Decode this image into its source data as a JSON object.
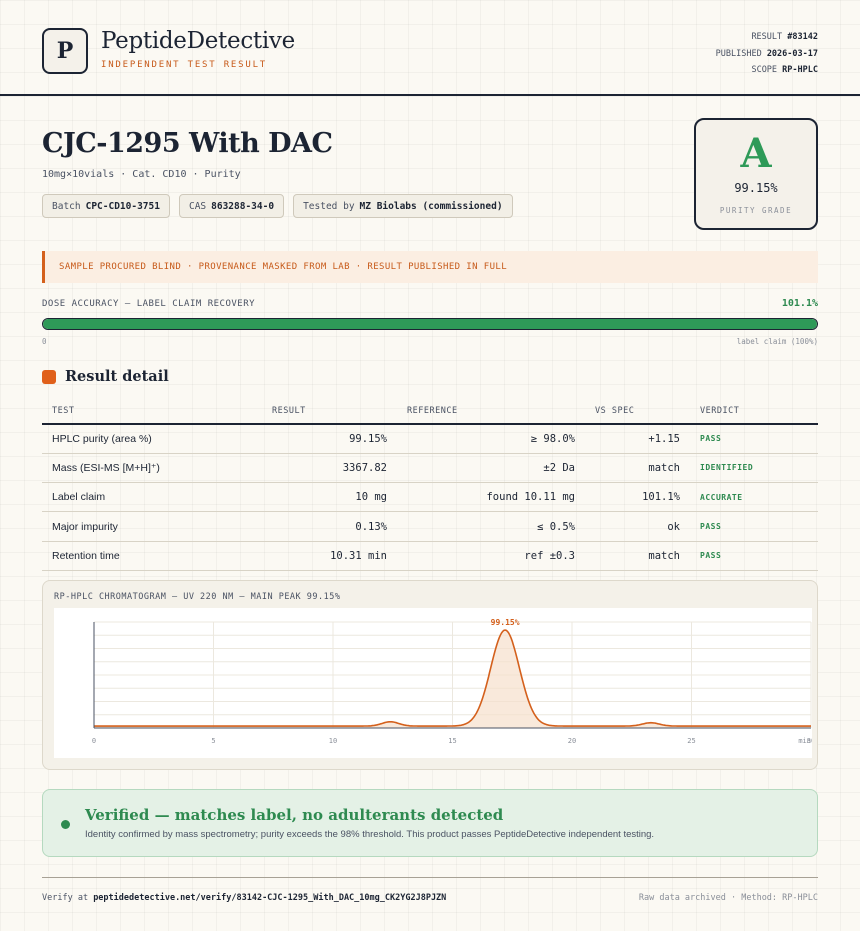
{
  "brand": {
    "logo_letter": "P",
    "name": "PeptideDetective",
    "tagline": "INDEPENDENT TEST RESULT"
  },
  "meta": {
    "result_label": "RESULT",
    "result_value": "#83142",
    "published_label": "PUBLISHED",
    "published_value": "2026-03-17",
    "scope_label": "SCOPE",
    "scope_value": "RP-HPLC"
  },
  "product": {
    "title": "CJC-1295 With DAC",
    "subtitle": "10mg×10vials · Cat. CD10 · Purity",
    "chips": {
      "batch_label": "Batch",
      "batch_value": "CPC-CD10-3751",
      "cas_label": "CAS",
      "cas_value": "863288-34-0",
      "tested_label": "Tested by",
      "tested_value": "MZ Biolabs (commissioned)"
    }
  },
  "grade": {
    "letter": "A",
    "percent": "99.15%",
    "label": "PURITY GRADE",
    "color": "#2e9a58"
  },
  "banner": "SAMPLE PROCURED BLIND · PROVENANCE MASKED FROM LAB · RESULT PUBLISHED IN FULL",
  "dose": {
    "label": "DOSE ACCURACY — LABEL CLAIM RECOVERY",
    "value_text": "101.1%",
    "fill_fraction": 1.0,
    "min_label": "0",
    "max_label": "label claim (100%)"
  },
  "section_title": "Result detail",
  "table": {
    "headers": [
      "TEST",
      "RESULT",
      "REFERENCE",
      "VS SPEC",
      "VERDICT"
    ],
    "rows": [
      {
        "test": "HPLC purity (area %)",
        "result": "99.15%",
        "reference": "≥ 98.0%",
        "vs_spec": "+1.15",
        "verdict": "PASS"
      },
      {
        "test": "Mass (ESI-MS [M+H]⁺)",
        "result": "3367.82",
        "reference": "±2 Da",
        "vs_spec": "match",
        "verdict": "IDENTIFIED"
      },
      {
        "test": "Label claim",
        "result": "10 mg",
        "reference": "found 10.11 mg",
        "vs_spec": "101.1%",
        "verdict": "ACCURATE"
      },
      {
        "test": "Major impurity",
        "result": "0.13%",
        "reference": "≤ 0.5%",
        "vs_spec": "ok",
        "verdict": "PASS"
      },
      {
        "test": "Retention time",
        "result": "10.31 min",
        "reference": "ref ±0.3",
        "vs_spec": "match",
        "verdict": "PASS"
      }
    ]
  },
  "chart_data": {
    "type": "line",
    "title": "RP-HPLC CHROMATOGRAM — UV 220 NM — MAIN PEAK 99.15%",
    "xlabel": "",
    "ylabel": "",
    "xlim": [
      0,
      30
    ],
    "x_ticks": [
      "0",
      "5",
      "10",
      "15",
      "20",
      "25",
      "30"
    ],
    "x_tick_suffix": "min",
    "baseline": 0.02,
    "peaks": [
      {
        "center": 12.4,
        "height": 0.045,
        "width": 0.35
      },
      {
        "center": 17.2,
        "height": 1.0,
        "width": 0.6,
        "label": "99.15%"
      },
      {
        "center": 23.3,
        "height": 0.035,
        "width": 0.35
      }
    ],
    "color": "#d4601c",
    "fill": "#f6dfcc"
  },
  "verified": {
    "title": "Verified — matches label, no adulterants detected",
    "text": "Identity confirmed by mass spectrometry; purity exceeds the 98% threshold. This product passes PeptideDetective independent testing."
  },
  "footer": {
    "verify_prefix": "Verify at",
    "verify_url": "peptidedetective.net/verify/83142-CJC-1295_With_DAC_10mg_CK2YG2J8PJZN",
    "right": "Raw data archived · Method: RP-HPLC"
  }
}
